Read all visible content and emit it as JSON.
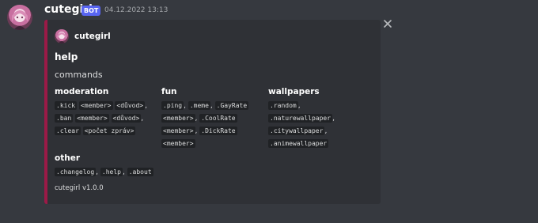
{
  "message": {
    "username": "cutegirl",
    "bot_tag": "BOT",
    "timestamp": "04.12.2022 13:13"
  },
  "embed": {
    "author": "cutegirl",
    "title": "help",
    "description": "commands",
    "accent_color": "#9b1a47",
    "fields": {
      "moderation": {
        "name": "moderation",
        "lines": [
          [
            ".kick",
            "<member>",
            "<důvod>",
            ","
          ],
          [
            ".ban",
            "<member>",
            "<důvod>",
            ","
          ],
          [
            ".clear",
            "<počet zpráv>"
          ]
        ]
      },
      "fun": {
        "name": "fun",
        "codes": [
          ".ping",
          ".meme",
          ".GayRate",
          "<member>",
          ".CoolRate",
          "<member>",
          ".DickRate",
          "<member>"
        ]
      },
      "wallpapers": {
        "name": "wallpapers",
        "codes": [
          ".random",
          ".naturewallpaper",
          ".citywallpaper",
          ".animewallpaper"
        ]
      },
      "other": {
        "name": "other",
        "codes": [
          ".changelog",
          ".help",
          ".about"
        ]
      }
    },
    "footer": "cutegirl v1.0.0"
  },
  "icons": {
    "avatar": "anime-girl-avatar",
    "close": "close-icon"
  },
  "colors": {
    "background": "#36393f",
    "embed_background": "#2f3136",
    "bot_tag": "#5865f2"
  }
}
